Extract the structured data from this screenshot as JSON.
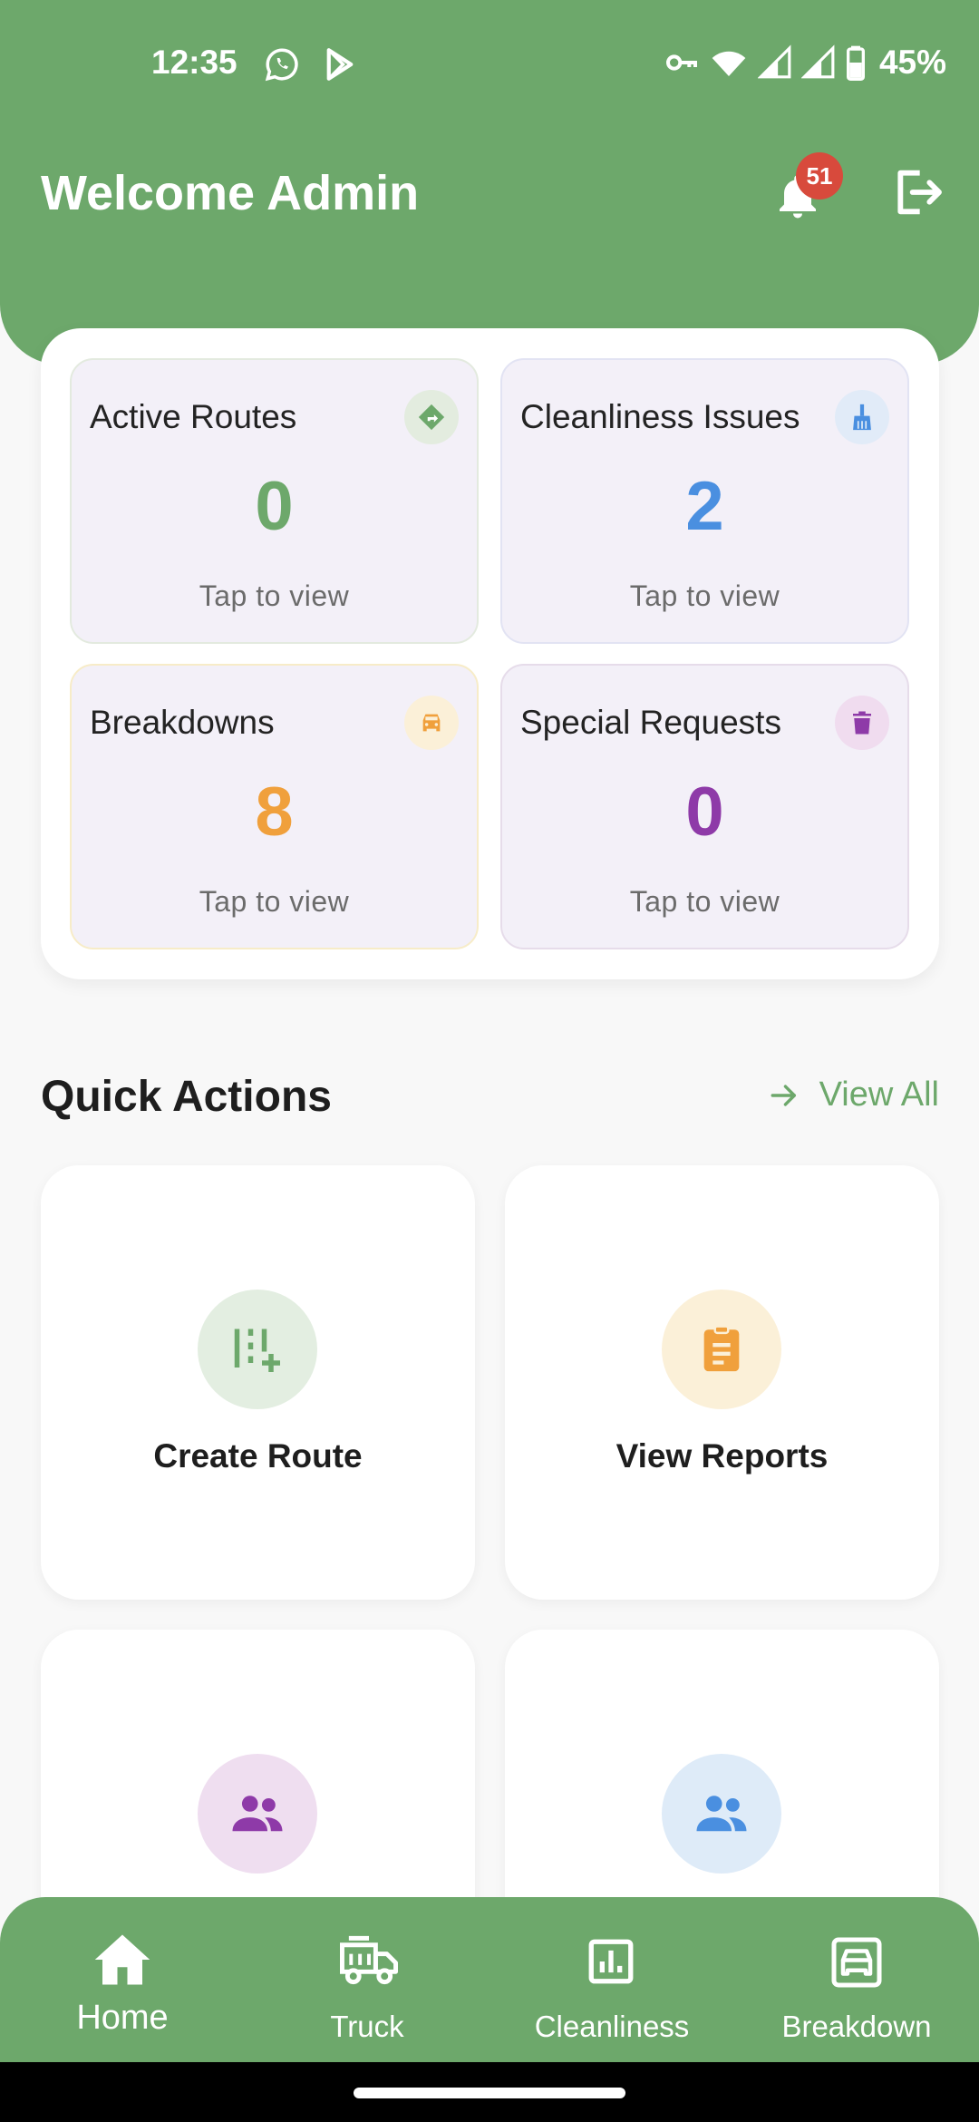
{
  "status_bar": {
    "time": "12:35",
    "battery": "45%",
    "icons": [
      "whatsapp-icon",
      "play-store-icon",
      "vpn-key-icon",
      "wifi-icon",
      "signal-icon",
      "signal-icon",
      "battery-icon"
    ]
  },
  "header": {
    "welcome": "Welcome Admin",
    "notification_count": "51"
  },
  "stats": [
    {
      "title": "Active Routes",
      "value": "0",
      "sub": "Tap to view",
      "icon": "route-icon",
      "color": "#6da86b"
    },
    {
      "title": "Cleanliness Issues",
      "value": "2",
      "sub": "Tap to view",
      "icon": "broom-icon",
      "color": "#4a8fe0"
    },
    {
      "title": "Breakdowns",
      "value": "8",
      "sub": "Tap to view",
      "icon": "car-icon",
      "color": "#f0a03c"
    },
    {
      "title": "Special Requests",
      "value": "0",
      "sub": "Tap to view",
      "icon": "trash-icon",
      "color": "#8e3aa8"
    }
  ],
  "quick_actions": {
    "title": "Quick Actions",
    "view_all": "View All",
    "items": [
      {
        "label": "Create Route",
        "icon": "add-route-icon",
        "color": "#6da86b"
      },
      {
        "label": "View Reports",
        "icon": "clipboard-icon",
        "color": "#f0a03c"
      },
      {
        "label": "",
        "icon": "people-icon",
        "color": "#8e3aa8"
      },
      {
        "label": "",
        "icon": "people-icon",
        "color": "#4a8fe0"
      }
    ]
  },
  "nav": {
    "items": [
      {
        "label": "Home",
        "icon": "home-icon",
        "active": true
      },
      {
        "label": "Truck",
        "icon": "truck-icon",
        "active": false
      },
      {
        "label": "Cleanliness",
        "icon": "bar-chart-icon",
        "active": false
      },
      {
        "label": "Breakdown",
        "icon": "car-icon",
        "active": false
      }
    ]
  }
}
